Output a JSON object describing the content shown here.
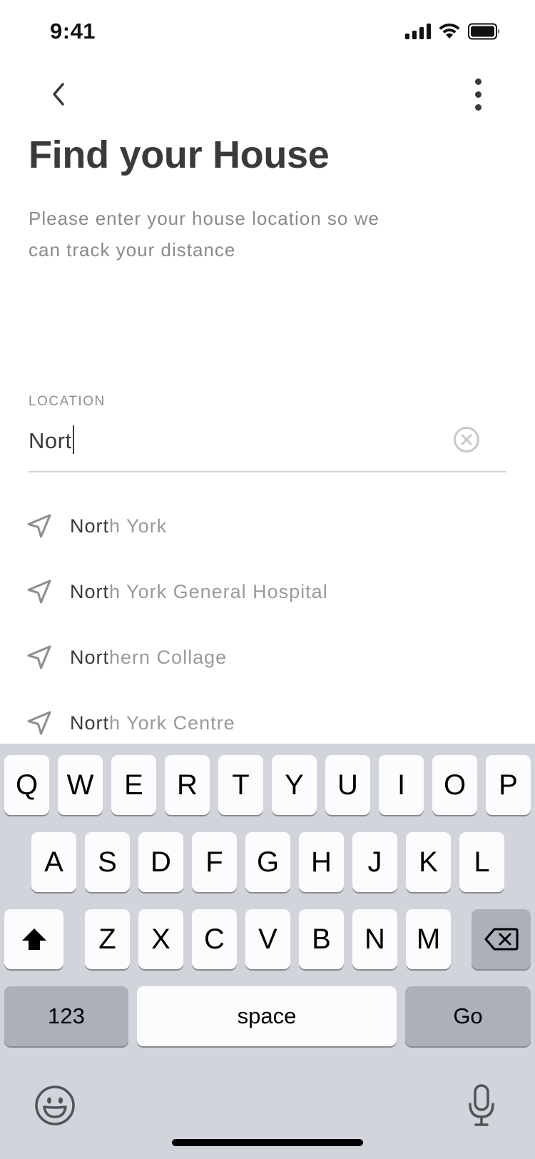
{
  "status_bar": {
    "time": "9:41"
  },
  "header": {
    "title": "Find your House",
    "subtitle": "Please enter your house location so we can track your distance"
  },
  "location_field": {
    "label": "LOCATION",
    "value": "Nort"
  },
  "suggestions": [
    {
      "match": "Nort",
      "rest": "h York"
    },
    {
      "match": "Nort",
      "rest": "h York General Hospital"
    },
    {
      "match": "Nort",
      "rest": "hern Collage"
    },
    {
      "match": "Nort",
      "rest": "h York Centre"
    }
  ],
  "keyboard": {
    "row1": [
      "Q",
      "W",
      "E",
      "R",
      "T",
      "Y",
      "U",
      "I",
      "O",
      "P"
    ],
    "row2": [
      "A",
      "S",
      "D",
      "F",
      "G",
      "H",
      "J",
      "K",
      "L"
    ],
    "row3": [
      "Z",
      "X",
      "C",
      "V",
      "B",
      "N",
      "M"
    ],
    "numbers_label": "123",
    "space_label": "space",
    "go_label": "Go"
  },
  "icons": {
    "back": "chevron-left-icon",
    "more": "more-vertical-icon",
    "clear": "clear-circle-icon",
    "suggestion": "navigation-arrow-icon",
    "shift": "shift-icon",
    "delete": "backspace-icon",
    "emoji": "emoji-icon",
    "mic": "microphone-icon"
  }
}
